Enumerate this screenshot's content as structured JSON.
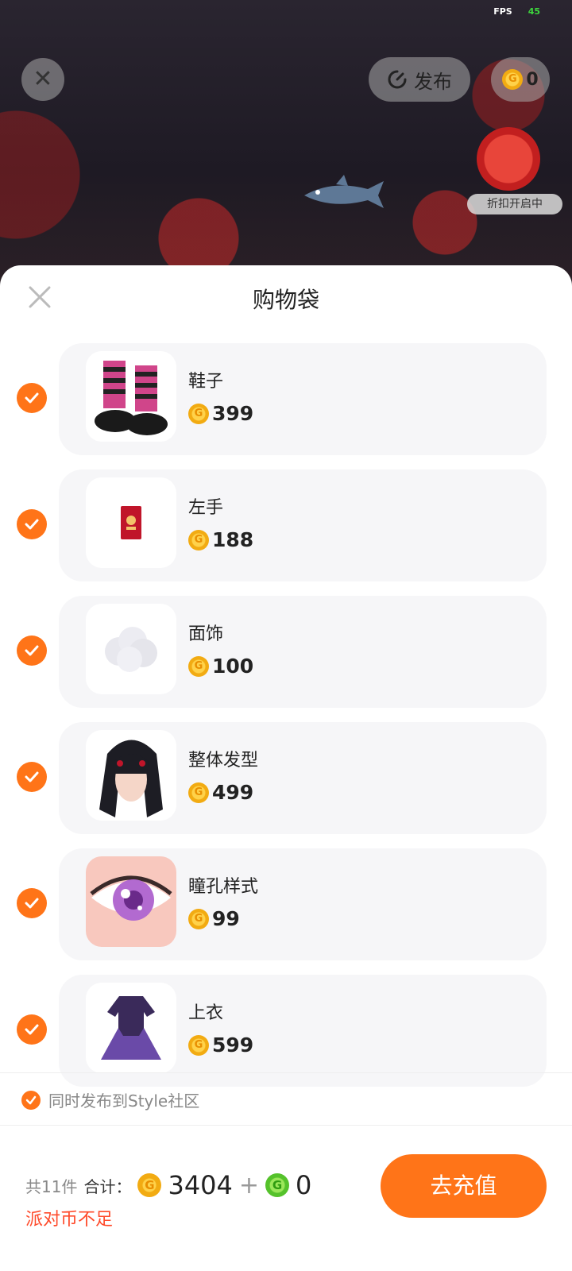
{
  "scene": {
    "fps_label": "FPS",
    "fps_value": "45",
    "publish_label": "发布",
    "coin_balance": "0",
    "discount_badge": "折扣开启中"
  },
  "sheet": {
    "title": "购物袋",
    "items": [
      {
        "name": "鞋子",
        "price": "399",
        "thumb": "boots"
      },
      {
        "name": "左手",
        "price": "188",
        "thumb": "red-envelope"
      },
      {
        "name": "面饰",
        "price": "100",
        "thumb": "cloud-mask"
      },
      {
        "name": "整体发型",
        "price": "499",
        "thumb": "black-hair"
      },
      {
        "name": "瞳孔样式",
        "price": "99",
        "thumb": "purple-eye"
      },
      {
        "name": "上衣",
        "price": "599",
        "thumb": "purple-dress"
      }
    ],
    "sync_label": "同时发布到Style社区"
  },
  "footer": {
    "count_text": "共11件",
    "sum_label": "合计：",
    "gold_total": "3404",
    "plus": "+",
    "green_total": "0",
    "insufficient": "派对币不足",
    "recharge_label": "去充值"
  },
  "colors": {
    "accent": "#ff7418",
    "warning": "#ff4a2a",
    "coin_gold": "#f2ab12",
    "coin_green": "#55c22b"
  },
  "icons": [
    "close-icon",
    "publish-refresh-icon",
    "gold-coin-icon",
    "green-coin-icon",
    "checkmark-icon"
  ]
}
